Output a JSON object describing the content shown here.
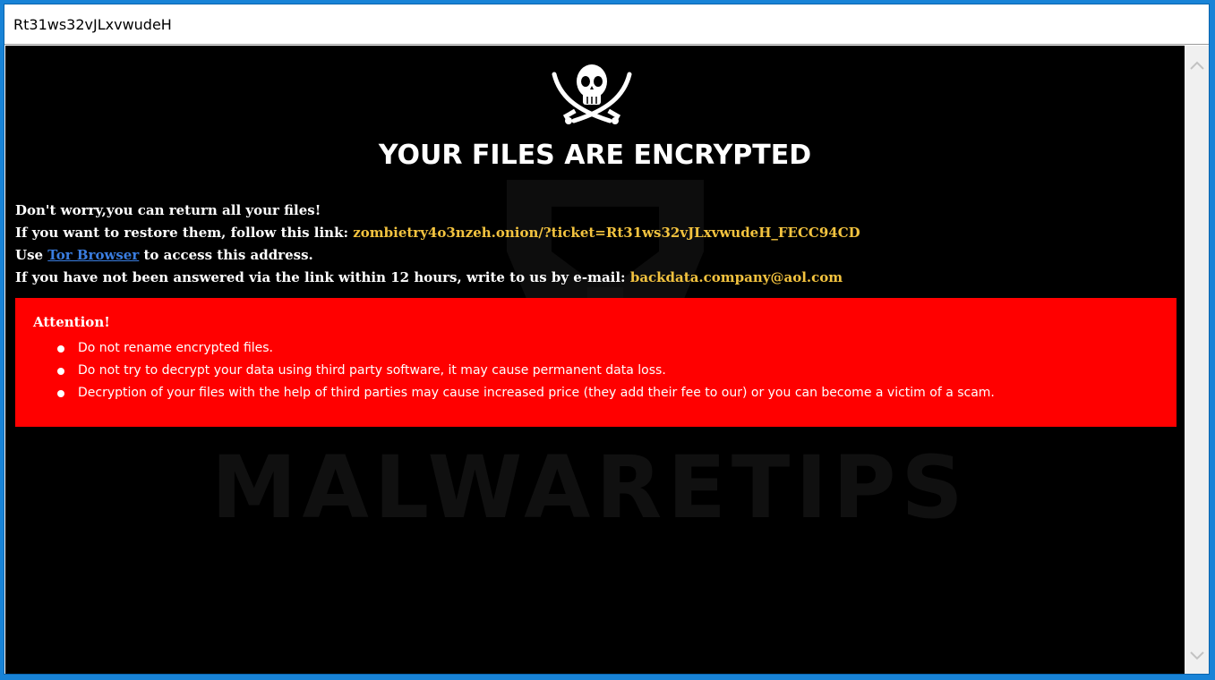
{
  "window": {
    "title": "Rt31ws32vJLxvwudeH"
  },
  "note": {
    "headline": "YOUR FILES ARE ENCRYPTED",
    "line1": "Don't worry,you can return all your files!",
    "line2_prefix": "If you want to restore them, follow this link: ",
    "link": "zombietry4o3nzeh.onion/?ticket=Rt31ws32vJLxvwudeH_FECC94CD",
    "line3_prefix": "Use ",
    "tor_link": "Tor Browser",
    "line3_suffix": " to access this address.",
    "line4_prefix": "If you have not been answered via the link within 12 hours, write to us by e-mail: ",
    "email": "backdata.company@aol.com"
  },
  "attention": {
    "title": "Attention!",
    "items": [
      "Do not rename encrypted files.",
      "Do not try to decrypt your data using third party software, it may cause permanent data loss.",
      "Decryption of your files with the help of third parties may cause increased price (they add their fee to our) or you can become a victim of a scam."
    ]
  },
  "watermark": {
    "text": "MALWARETIPS"
  },
  "icons": {
    "logo": "skull-crossed-swords-icon",
    "scroll_up": "chevron-up-icon",
    "scroll_down": "chevron-down-icon"
  },
  "colors": {
    "background": "#000000",
    "highlight": "#f3c33f",
    "link": "#3a7de0",
    "alert": "#ff0000",
    "frame": "#1883d7"
  }
}
